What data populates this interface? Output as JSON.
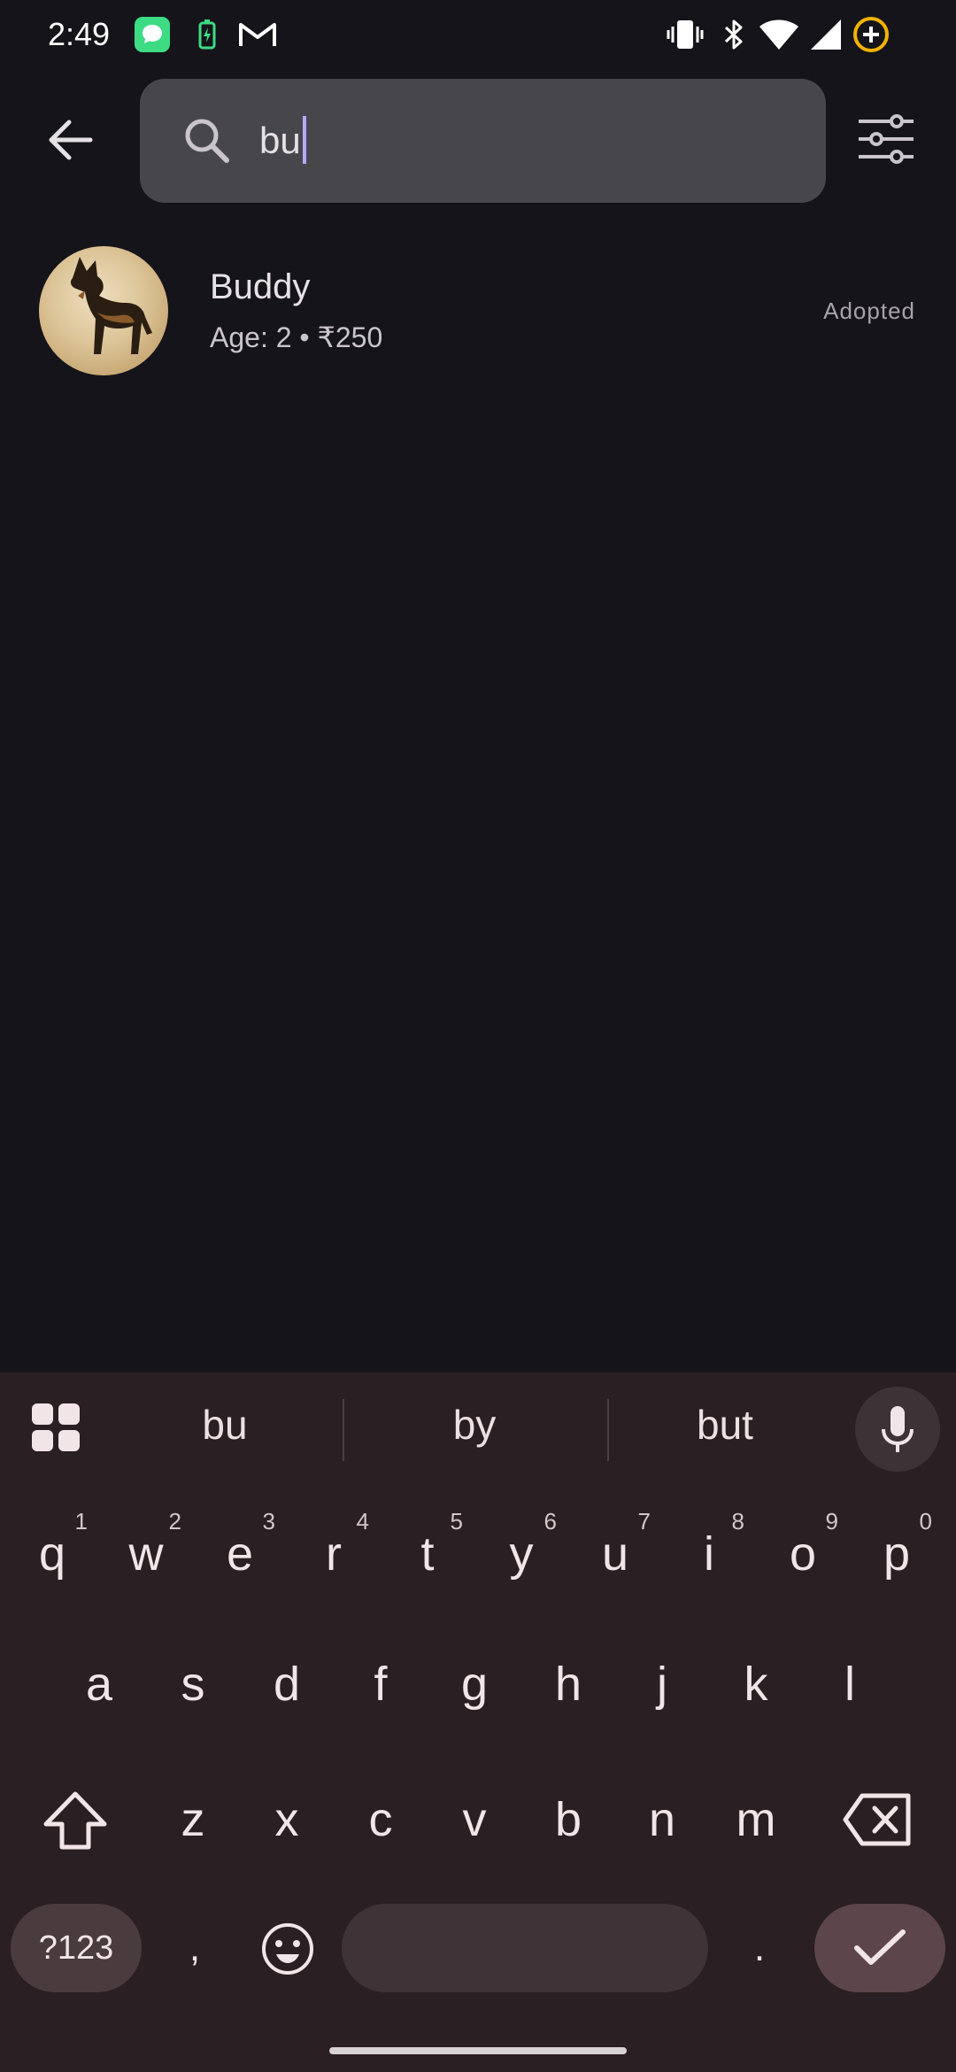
{
  "status_bar": {
    "time": "2:49",
    "icons": [
      "messages-app-icon",
      "battery-saver-icon",
      "gmail-icon",
      "vibrate-icon",
      "bluetooth-icon",
      "wifi-icon",
      "cellular-signal-icon",
      "battery-plus-icon"
    ]
  },
  "search": {
    "query": "bu",
    "back_icon": "arrow-left-icon",
    "search_icon": "search-icon",
    "filter_icon": "tune-sliders-icon"
  },
  "results": [
    {
      "name": "Buddy",
      "meta": "Age: 2 • ₹250",
      "status": "Adopted",
      "avatar": "german-shepherd-photo"
    }
  ],
  "keyboard": {
    "suggestions": [
      "bu",
      "by",
      "but"
    ],
    "row1": [
      {
        "key": "q",
        "hint": "1"
      },
      {
        "key": "w",
        "hint": "2"
      },
      {
        "key": "e",
        "hint": "3"
      },
      {
        "key": "r",
        "hint": "4"
      },
      {
        "key": "t",
        "hint": "5"
      },
      {
        "key": "y",
        "hint": "6"
      },
      {
        "key": "u",
        "hint": "7"
      },
      {
        "key": "i",
        "hint": "8"
      },
      {
        "key": "o",
        "hint": "9"
      },
      {
        "key": "p",
        "hint": "0"
      }
    ],
    "row2": [
      "a",
      "s",
      "d",
      "f",
      "g",
      "h",
      "j",
      "k",
      "l"
    ],
    "row3": [
      "z",
      "x",
      "c",
      "v",
      "b",
      "n",
      "m"
    ],
    "symbols_label": "?123",
    "comma": ",",
    "period": "."
  },
  "colors": {
    "background": "#15141a",
    "search_field": "#47464b",
    "caret": "#b9a8ff",
    "keyboard": "#2a1f22"
  }
}
